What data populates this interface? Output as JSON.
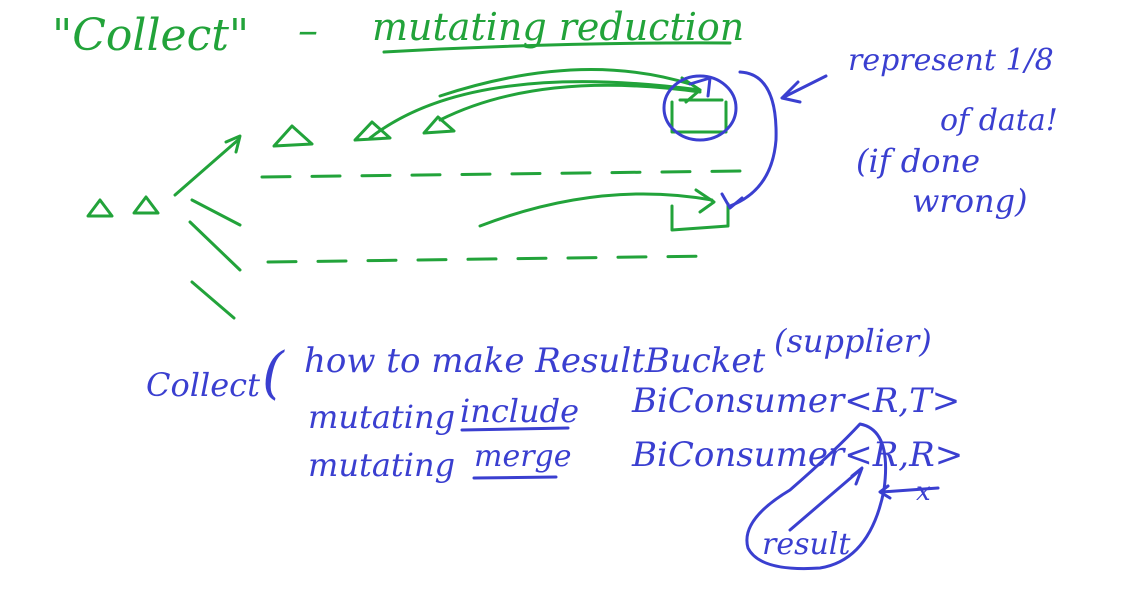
{
  "title": {
    "quoted": "\"Collect\"",
    "dash": "–",
    "subtitle": "mutating reduction"
  },
  "side_note": {
    "line1": "represent 1/8",
    "line2": "of data!",
    "line3": "(if done",
    "line4": "wrong)"
  },
  "collect_signature": {
    "word": "Collect",
    "paren_open": "(",
    "how_to_make": "how to make ResultBucket",
    "supplier": "(supplier)",
    "mutating": "mutating",
    "include": "include",
    "merging": "mutating",
    "merge": "merge",
    "sig_include": "BiConsumer<R,T>",
    "sig_merge": "BiConsumer<R,R>",
    "result_label": "result",
    "x_mark": "x"
  },
  "colors": {
    "green_ink": "#22a33a",
    "blue_ink": "#3a3fd0"
  }
}
